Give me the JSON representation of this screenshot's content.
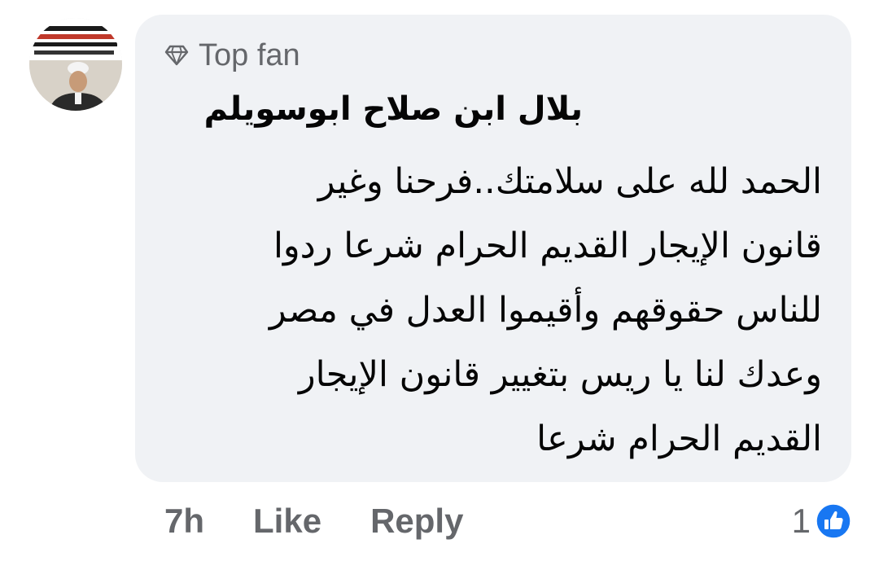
{
  "comment": {
    "badge": "Top fan",
    "author": "بلال ابن صلاح ابوسويلم",
    "lines": [
      "الحمد لله على سلامتك..فرحنا وغير",
      "قانون الإيجار القديم الحرام شرعا ردوا",
      "للناس حقوقهم وأقيموا العدل في مصر",
      "وعدك لنا يا ريس بتغيير قانون الإيجار",
      "القديم الحرام شرعا"
    ]
  },
  "actions": {
    "time": "7h",
    "like": "Like",
    "reply": "Reply"
  },
  "reactions": {
    "count": "1",
    "icon": "like-reaction-icon"
  },
  "icons": {
    "badge": "diamond-icon"
  },
  "colors": {
    "bubble": "#f0f2f5",
    "text": "#050505",
    "secondary": "#65676b",
    "like_blue": "#1877f2"
  }
}
